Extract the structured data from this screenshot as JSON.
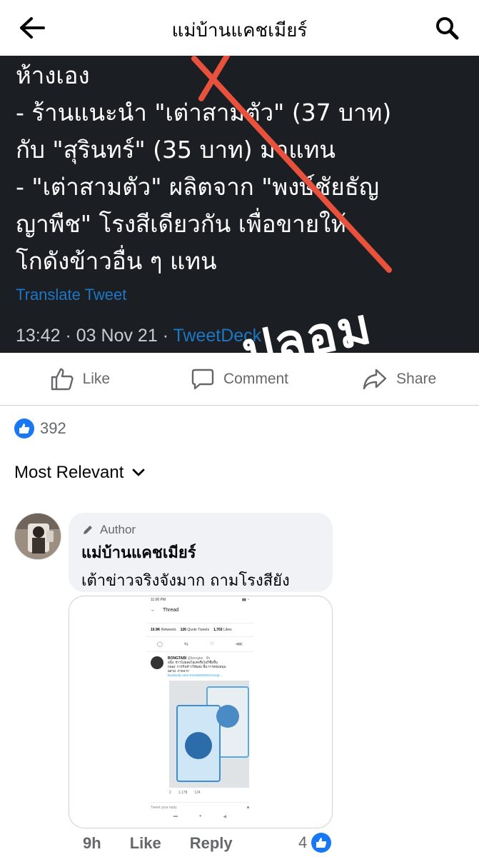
{
  "header": {
    "title": "แม่บ้านแคชเมียร์",
    "back_icon": "arrow-left-icon",
    "search_icon": "search-icon"
  },
  "post_image": {
    "tweet_text": "ห้างเอง\n- ร้านแนะนำ \"เต่าสามตัว\" (37 บาท)\nกับ \"สุรินทร์\" (35 บาท) มาแทน\n- \"เต่าสามตัว\" ผลิตจาก \"พงษ์ชัยธัญ\nญาพืช\" โรงสีเดียวกัน เพื่อขายให้\nโกดังข้าวอื่น ๆ แทน",
    "translate_label": "Translate Tweet",
    "time": "13:42 · 03 Nov 21 · ",
    "source": "TweetDeck",
    "stamp": "ปลอม",
    "cross_color": "#e8513c"
  },
  "actions": {
    "like": "Like",
    "comment": "Comment",
    "share": "Share"
  },
  "reactions": {
    "count": "392"
  },
  "sort": {
    "label": "Most Relevant"
  },
  "comment": {
    "badge": "Author",
    "name": "แม่บ้านแคชเมียร์",
    "text": "เต้าข่าวจริงจังมาก ถามโรงสียัง",
    "time": "9h",
    "like_label": "Like",
    "reply_label": "Reply",
    "reaction_count": "4",
    "attachment": {
      "status_time": "11:00 PM",
      "title": "Thread",
      "stats_retweets": "10.9K",
      "stats_retweets_label": "Retweets",
      "stats_quotes": "126",
      "stats_quotes_label": "Quote Tweets",
      "stats_likes": "1,703",
      "stats_likes_label": "Likes",
      "user": "BONGTABI",
      "handle": "@bongtai · 9h",
      "body1": "อนึ่ง: ข้าวไม่ผสมโอเคหรือไม่ก็ซื้อขึ้น",
      "body2": "ถลอง: การกินข้าวให้ผสม พื้อ การสนับสนุน",
      "body3": "อสาม: ภาพจาก",
      "link": "facebook.com/ KHAWSONGCHAUp...",
      "reply_count": "2",
      "retweet_count": "1,178",
      "like_count": "124",
      "reply_placeholder": "Tweet your reply"
    }
  }
}
